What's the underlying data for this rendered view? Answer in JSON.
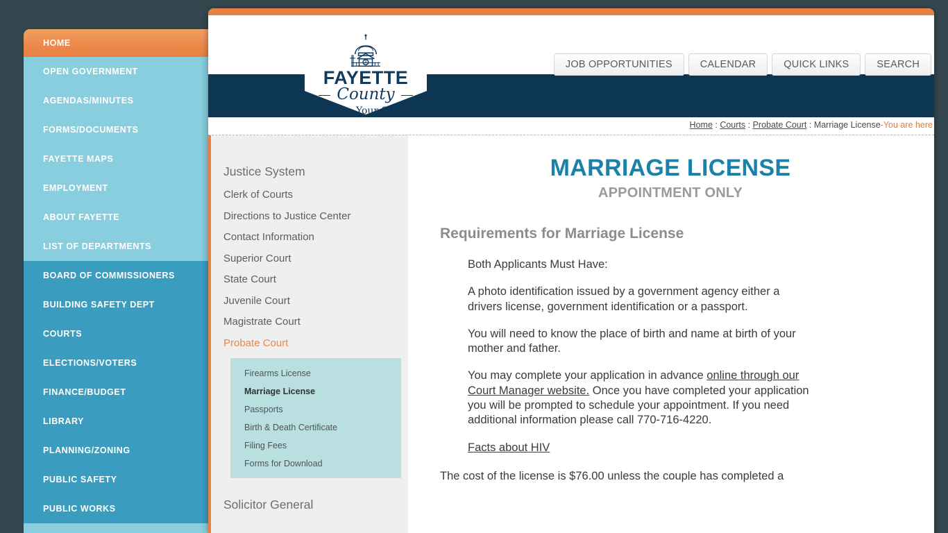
{
  "global_nav": [
    {
      "label": "HOME",
      "state": "active"
    },
    {
      "label": "OPEN GOVERNMENT",
      "state": "light"
    },
    {
      "label": "AGENDAS/MINUTES",
      "state": "light"
    },
    {
      "label": "FORMS/DOCUMENTS",
      "state": "light"
    },
    {
      "label": "FAYETTE MAPS",
      "state": "light"
    },
    {
      "label": "EMPLOYMENT",
      "state": "light"
    },
    {
      "label": "ABOUT FAYETTE",
      "state": "light"
    },
    {
      "label": "LIST OF DEPARTMENTS",
      "state": "light"
    },
    {
      "label": "BOARD OF COMMISSIONERS",
      "state": "dark"
    },
    {
      "label": "BUILDING SAFETY DEPT",
      "state": "dark"
    },
    {
      "label": "COURTS",
      "state": "dark"
    },
    {
      "label": "ELECTIONS/VOTERS",
      "state": "dark"
    },
    {
      "label": "FINANCE/BUDGET",
      "state": "dark"
    },
    {
      "label": "LIBRARY",
      "state": "dark"
    },
    {
      "label": "PLANNING/ZONING",
      "state": "dark"
    },
    {
      "label": "PUBLIC SAFETY",
      "state": "dark"
    },
    {
      "label": "PUBLIC WORKS",
      "state": "dark"
    }
  ],
  "header": {
    "buttons": [
      {
        "label": "JOB OPPORTUNITIES"
      },
      {
        "label": "CALENDAR"
      },
      {
        "label": "QUICK LINKS"
      },
      {
        "label": "SEARCH"
      }
    ],
    "logo": {
      "name": "FAYETTE",
      "county": "County",
      "tagline": "Create Your Story!",
      "icon": "courthouse-dome-icon"
    }
  },
  "breadcrumb": {
    "items": [
      "Home",
      "Courts",
      "Probate Court"
    ],
    "current": "Marriage License",
    "you_are_here": "-You are here",
    "separator": " : "
  },
  "section_nav": {
    "groups": [
      {
        "title": "Justice System",
        "links": [
          {
            "label": "Clerk of Courts",
            "active": false
          },
          {
            "label": "Directions to Justice Center",
            "active": false
          },
          {
            "label": "Contact Information",
            "active": false
          },
          {
            "label": "Superior Court",
            "active": false
          },
          {
            "label": "State Court",
            "active": false
          },
          {
            "label": "Juvenile Court",
            "active": false
          },
          {
            "label": "Magistrate Court",
            "active": false
          },
          {
            "label": "Probate Court",
            "active": true
          }
        ],
        "sub_links": [
          {
            "label": "Firearms License",
            "active": false
          },
          {
            "label": "Marriage License",
            "active": true
          },
          {
            "label": "Passports",
            "active": false
          },
          {
            "label": "Birth & Death Certificate",
            "active": false
          },
          {
            "label": "Filing Fees",
            "active": false
          },
          {
            "label": "Forms for Download",
            "active": false
          }
        ]
      },
      {
        "title": "Solicitor General",
        "links": [],
        "sub_links": []
      }
    ]
  },
  "article": {
    "title": "MARRIAGE LICENSE",
    "subtitle": "APPOINTMENT ONLY",
    "requirements_heading": "Requirements for Marriage License",
    "paragraphs": {
      "p1": "Both Applicants Must Have:",
      "p2": "A photo identification issued by a government agency either a drivers license, government identification or a passport.",
      "p3": "You will need to know the place of birth and name at birth of your mother and father.",
      "p4_pre": "You may complete your application in advance ",
      "p4_link": "online through our Court Manager website.",
      "p4_post": " Once you have completed your application you will be prompted to schedule your appointment. If you need additional information please call 770-716-4220.",
      "p5_link": "Facts about HIV",
      "p6": "The cost of the license is $76.00 unless the couple has completed a"
    }
  },
  "colors": {
    "accent_orange": "#e8803f",
    "nav_light_blue": "#88cede",
    "nav_dark_teal": "#3a9dc0",
    "navy": "#0d3655",
    "title_teal": "#1b81a8",
    "subnav_teal": "#b9dfe1",
    "page_backdrop": "#34474f"
  }
}
